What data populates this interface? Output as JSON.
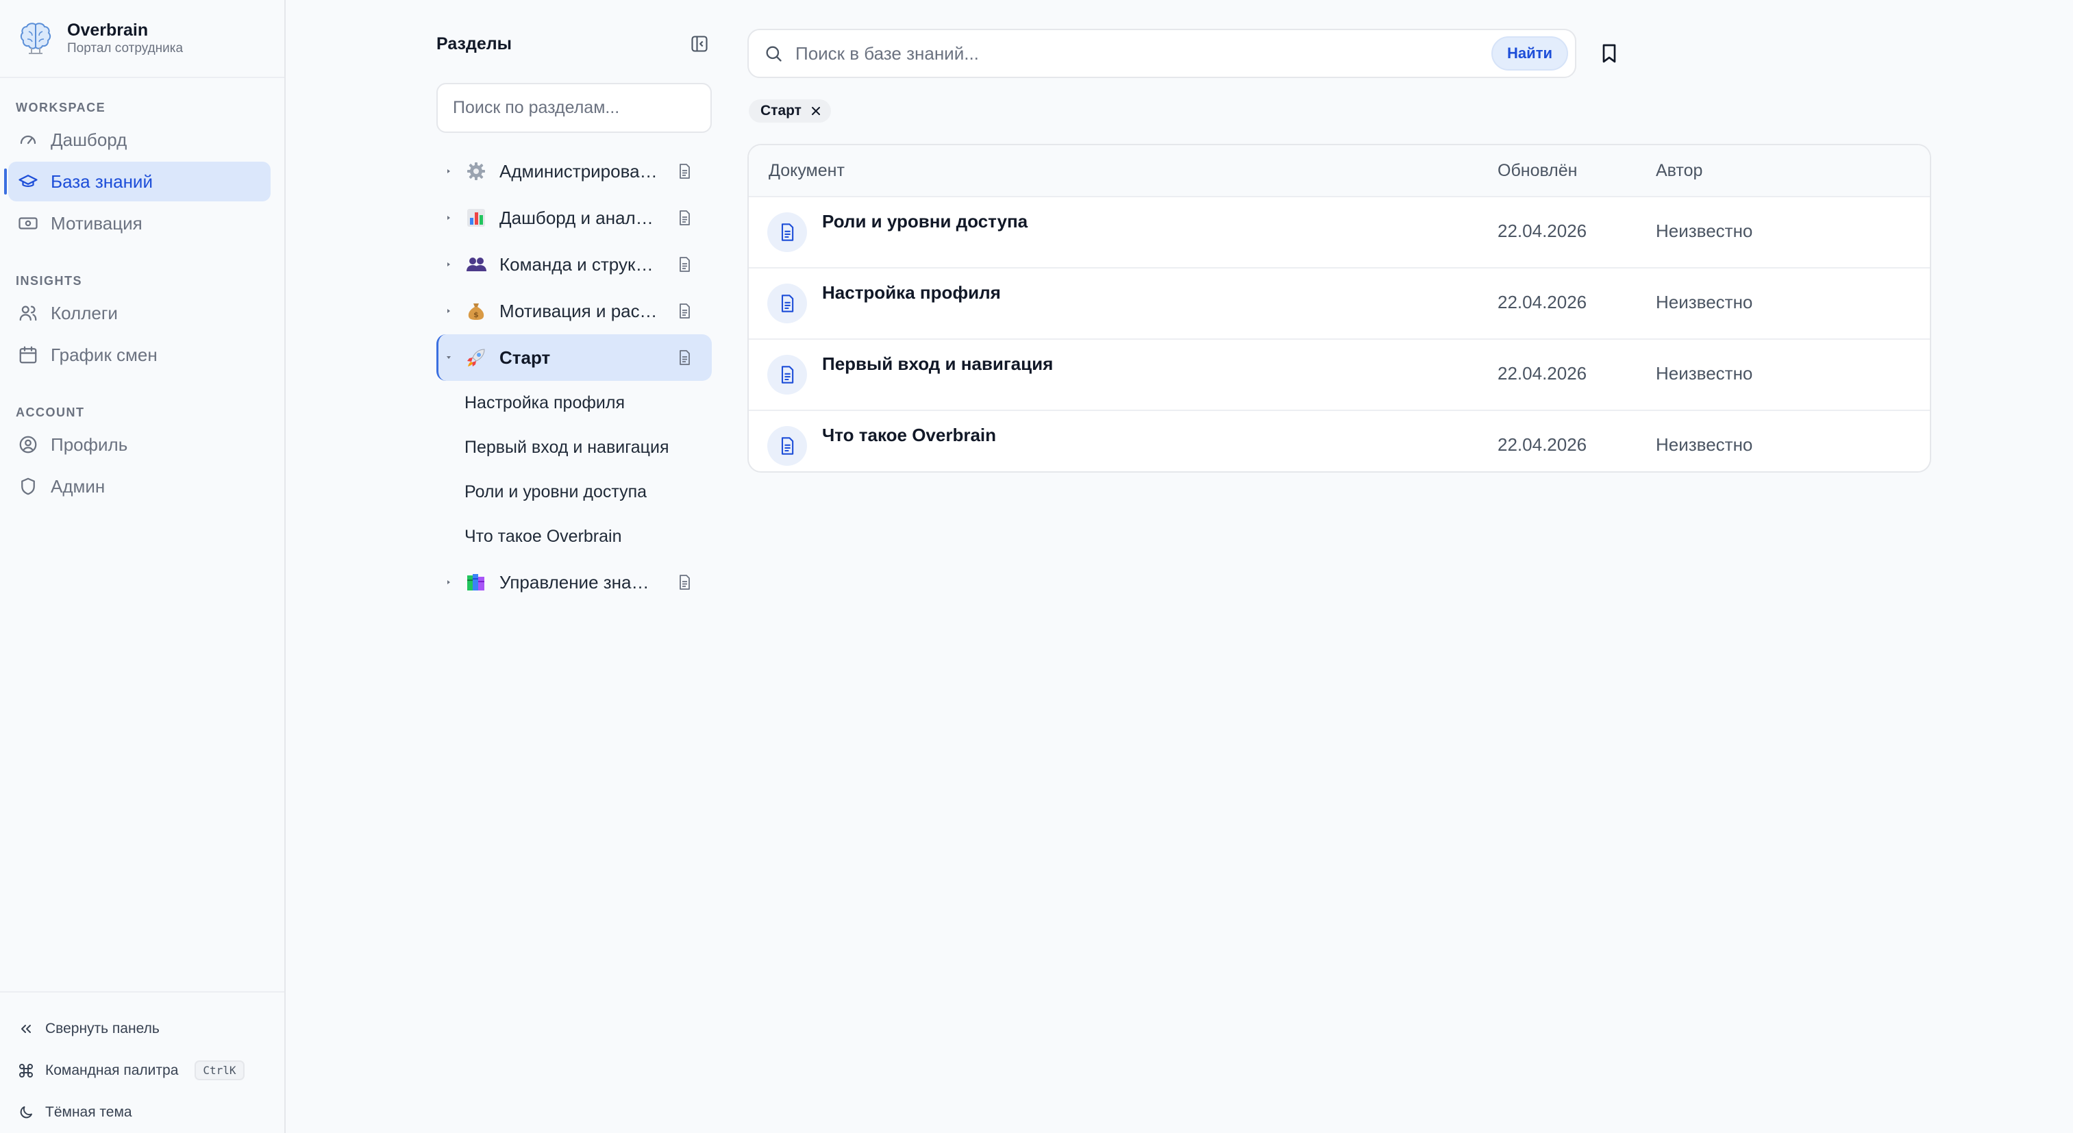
{
  "app": {
    "name": "Overbrain",
    "subtitle": "Портал сотрудника"
  },
  "sidebar": {
    "sections": [
      {
        "heading": "WORKSPACE",
        "items": [
          {
            "label": "Дашборд",
            "icon": "gauge-icon",
            "active": false
          },
          {
            "label": "База знаний",
            "icon": "graduation-cap-icon",
            "active": true
          },
          {
            "label": "Мотивация",
            "icon": "banknote-icon",
            "active": false
          }
        ]
      },
      {
        "heading": "INSIGHTS",
        "items": [
          {
            "label": "Коллеги",
            "icon": "users-icon",
            "active": false
          },
          {
            "label": "График смен",
            "icon": "calendar-icon",
            "active": false
          }
        ]
      },
      {
        "heading": "ACCOUNT",
        "items": [
          {
            "label": "Профиль",
            "icon": "user-circle-icon",
            "active": false
          },
          {
            "label": "Админ",
            "icon": "shield-icon",
            "active": false
          }
        ]
      }
    ],
    "footer": {
      "collapse_label": "Свернуть панель",
      "command_palette_label": "Командная палитра",
      "command_palette_shortcut": "CtrlK",
      "theme_label": "Тёмная тема"
    }
  },
  "sections_panel": {
    "title": "Разделы",
    "search_placeholder": "Поиск по разделам...",
    "tree": [
      {
        "label": "Администрирование",
        "emoji": "gear-emoji-icon",
        "expanded": false
      },
      {
        "label": "Дашборд и аналитика",
        "emoji": "bar-chart-emoji-icon",
        "expanded": false
      },
      {
        "label": "Команда и структура",
        "emoji": "people-emoji-icon",
        "expanded": false
      },
      {
        "label": "Мотивация и расчёты",
        "emoji": "money-bag-emoji-icon",
        "expanded": false
      },
      {
        "label": "Старт",
        "emoji": "rocket-emoji-icon",
        "expanded": true,
        "active": true,
        "children": [
          "Настройка профиля",
          "Первый вход и навигация",
          "Роли и уровни доступа",
          "Что такое Overbrain"
        ]
      },
      {
        "label": "Управление знаниями",
        "emoji": "books-emoji-icon",
        "expanded": false
      }
    ]
  },
  "search": {
    "placeholder": "Поиск в базе знаний...",
    "button_label": "Найти"
  },
  "filter_chip": {
    "label": "Старт"
  },
  "table": {
    "headers": {
      "document": "Документ",
      "updated": "Обновлён",
      "author": "Автор"
    },
    "rows": [
      {
        "title": "Роли и уровни доступа",
        "updated": "22.04.2026",
        "author": "Неизвестно"
      },
      {
        "title": "Настройка профиля",
        "updated": "22.04.2026",
        "author": "Неизвестно"
      },
      {
        "title": "Первый вход и навигация",
        "updated": "22.04.2026",
        "author": "Неизвестно"
      },
      {
        "title": "Что такое Overbrain",
        "updated": "22.04.2026",
        "author": "Неизвестно"
      }
    ]
  },
  "colors": {
    "accent": "#3b6fe0",
    "active_bg": "#dbe7fb",
    "active_text": "#1d4ed8"
  }
}
